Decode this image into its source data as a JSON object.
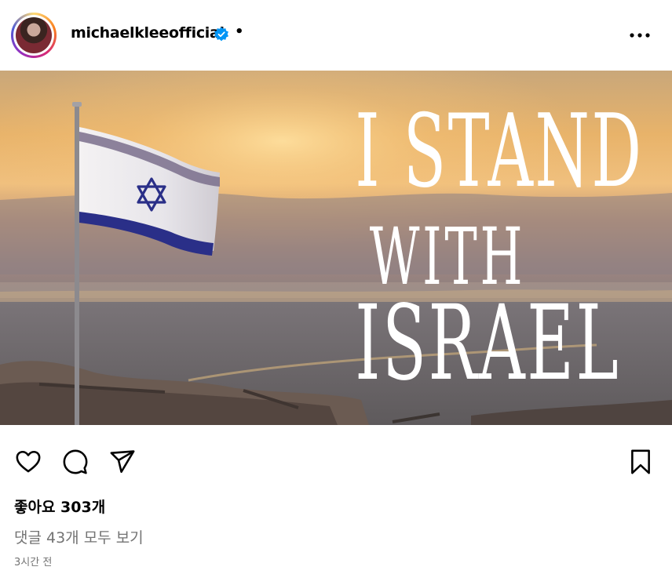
{
  "post": {
    "username": "michaelkleeofficial",
    "verified": true,
    "separator": "•",
    "more_icon": "more-horizontal-icon",
    "image": {
      "text_lines": [
        "I STAND",
        "WITH",
        "ISRAEL"
      ],
      "description_icon": "israel-flag"
    },
    "actions": {
      "like_icon": "heart-icon",
      "comment_icon": "comment-icon",
      "share_icon": "share-icon",
      "save_icon": "bookmark-icon"
    },
    "likes_text": "좋아요 303개",
    "comments_text": "댓글 43개 모두 보기",
    "time_text": "3시간 전"
  },
  "colors": {
    "verified_blue": "#0095f6",
    "muted_text": "#737373"
  }
}
